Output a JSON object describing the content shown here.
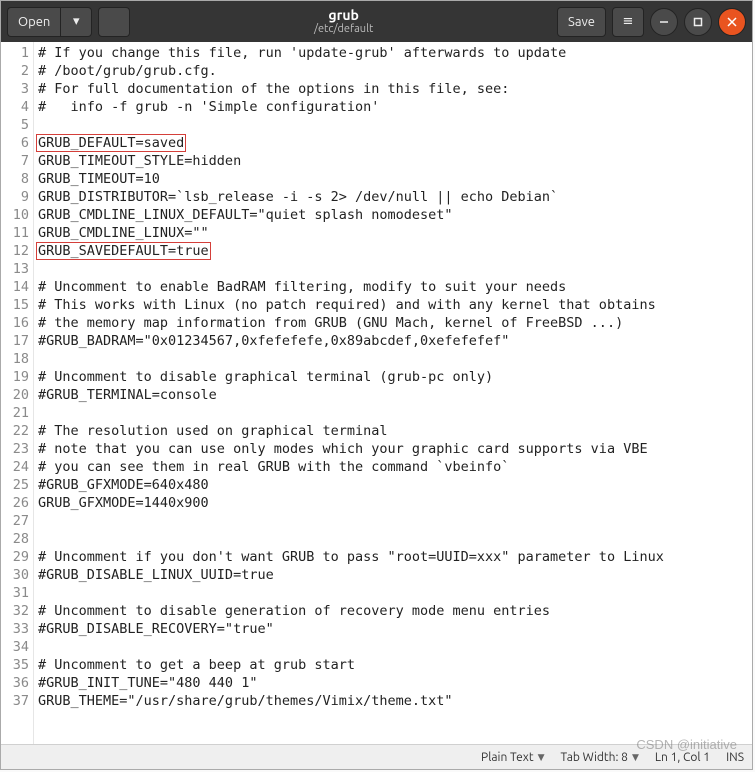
{
  "header": {
    "open_label": "Open",
    "save_label": "Save",
    "title": "grub",
    "subtitle": "/etc/default"
  },
  "editor": {
    "highlighted_lines": [
      6,
      12
    ],
    "lines": [
      "# If you change this file, run 'update-grub' afterwards to update",
      "# /boot/grub/grub.cfg.",
      "# For full documentation of the options in this file, see:",
      "#   info -f grub -n 'Simple configuration'",
      "",
      "GRUB_DEFAULT=saved",
      "GRUB_TIMEOUT_STYLE=hidden",
      "GRUB_TIMEOUT=10",
      "GRUB_DISTRIBUTOR=`lsb_release -i -s 2> /dev/null || echo Debian`",
      "GRUB_CMDLINE_LINUX_DEFAULT=\"quiet splash nomodeset\"",
      "GRUB_CMDLINE_LINUX=\"\"",
      "GRUB_SAVEDEFAULT=true",
      "",
      "# Uncomment to enable BadRAM filtering, modify to suit your needs",
      "# This works with Linux (no patch required) and with any kernel that obtains",
      "# the memory map information from GRUB (GNU Mach, kernel of FreeBSD ...)",
      "#GRUB_BADRAM=\"0x01234567,0xfefefefe,0x89abcdef,0xefefefef\"",
      "",
      "# Uncomment to disable graphical terminal (grub-pc only)",
      "#GRUB_TERMINAL=console",
      "",
      "# The resolution used on graphical terminal",
      "# note that you can use only modes which your graphic card supports via VBE",
      "# you can see them in real GRUB with the command `vbeinfo`",
      "#GRUB_GFXMODE=640x480",
      "GRUB_GFXMODE=1440x900",
      "",
      "",
      "# Uncomment if you don't want GRUB to pass \"root=UUID=xxx\" parameter to Linux",
      "#GRUB_DISABLE_LINUX_UUID=true",
      "",
      "# Uncomment to disable generation of recovery mode menu entries",
      "#GRUB_DISABLE_RECOVERY=\"true\"",
      "",
      "# Uncomment to get a beep at grub start",
      "#GRUB_INIT_TUNE=\"480 440 1\"",
      "GRUB_THEME=\"/usr/share/grub/themes/Vimix/theme.txt\""
    ]
  },
  "statusbar": {
    "language": "Plain Text",
    "tab_label": "Tab Width: 8",
    "position": "Ln 1, Col 1",
    "ins": "INS"
  },
  "watermark": "CSDN @initiative"
}
